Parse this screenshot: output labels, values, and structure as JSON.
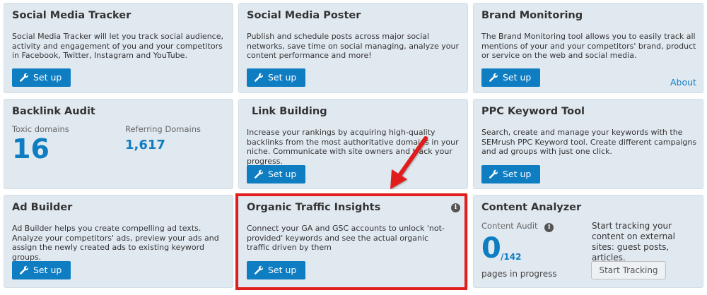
{
  "cards": {
    "smt": {
      "title": "Social Media Tracker",
      "desc": "Social Media Tracker will let you track social audience, activity and engagement of you and your competitors in Facebook, Twitter, Instagram and YouTube.",
      "button": "Set up"
    },
    "smp": {
      "title": "Social Media Poster",
      "desc": "Publish and schedule posts across major social networks, save time on social managing, analyze your content performance and more!",
      "button": "Set up"
    },
    "bm": {
      "title": "Brand Monitoring",
      "desc": "The Brand Monitoring tool allows you to easily track all mentions of your and your competitors' brand, product or service on the web and social media.",
      "button": "Set up",
      "about": "About"
    },
    "ba": {
      "title": "Backlink Audit",
      "toxic_label": "Toxic domains",
      "toxic_value": "16",
      "ref_label": "Referring Domains",
      "ref_value": "1,617"
    },
    "lb": {
      "title": "Link Building",
      "desc": "Increase your rankings by acquiring high-quality backlinks from the most authoritative domains in your niche. Communicate with site owners and track your progress.",
      "button": "Set up"
    },
    "ppc": {
      "title": "PPC Keyword Tool",
      "desc": "Search, create and manage your keywords with the SEMrush PPC Keyword tool. Create different campaigns and ad groups with just one click.",
      "button": "Set up"
    },
    "ab": {
      "title": "Ad Builder",
      "desc": "Ad Builder helps you create compelling ad texts. Analyze your competitors' ads, preview your ads and assign the newly created ads to existing keyword groups.",
      "button": "Set up"
    },
    "oti": {
      "title": "Organic Traffic Insights",
      "desc": "Connect your GA and GSC accounts to unlock 'not-provided' keywords and see the actual organic traffic driven by them",
      "button": "Set up"
    },
    "ca": {
      "title": "Content Analyzer",
      "audit_label": "Content Audit",
      "audit_value": "0",
      "audit_total": "/142",
      "audit_sub": "pages in progress",
      "promo": "Start tracking your content on external sites: guest posts, articles.",
      "button": "Start Tracking"
    }
  },
  "colors": {
    "accent": "#0e7dc2",
    "card_bg": "#e1e9f0",
    "highlight": "#e11d1d"
  },
  "icons": {
    "button_icon": "wrench-icon",
    "info": "info-icon",
    "annotation": "red-arrow"
  }
}
